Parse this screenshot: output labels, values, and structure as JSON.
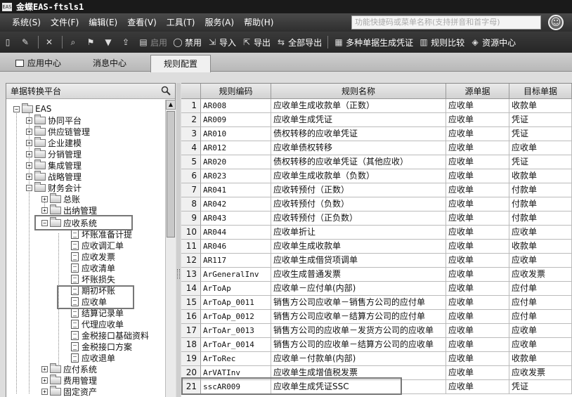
{
  "window": {
    "app_icon": "EAS",
    "title": "金蝶EAS-ftsls1"
  },
  "menu": [
    "系统(S)",
    "文件(F)",
    "编辑(E)",
    "查看(V)",
    "工具(T)",
    "服务(A)",
    "帮助(H)"
  ],
  "search": {
    "placeholder": "功能快捷码或菜单名称(支持拼音和首字母)"
  },
  "toolbar": {
    "icons_only": [
      "new-icon",
      "edit-icon",
      "delete-icon",
      "find-icon",
      "locate-icon",
      "filter-icon",
      "upload-icon"
    ],
    "enable_label": "启用",
    "disable_label": "禁用",
    "import_label": "导入",
    "export_label": "导出",
    "export_all_label": "全部导出",
    "multi_gen_label": "多种单据生成凭证",
    "compare_label": "规则比较",
    "resource_label": "资源中心"
  },
  "tabs": [
    "应用中心",
    "消息中心",
    "规则配置"
  ],
  "tree": {
    "header": "单据转换平台",
    "root": "EAS",
    "level1": [
      "协同平台",
      "供应链管理",
      "企业建模",
      "分销管理",
      "集成管理",
      "战略管理",
      "财务会计"
    ],
    "finance": [
      "总账",
      "出纳管理",
      "应收系统"
    ],
    "ar_children": [
      "坏账准备计提",
      "应收调汇单",
      "应收发票",
      "应收清单",
      "坏账损失",
      "期初坏账",
      "应收单",
      "结算记录单",
      "代理应收单",
      "金税接口基础资料",
      "金税接口方案",
      "应收退单"
    ],
    "after": [
      "应付系统",
      "费用管理",
      "固定资产"
    ]
  },
  "table": {
    "headers": [
      "规则编码",
      "规则名称",
      "源单据",
      "目标单据"
    ],
    "rows": [
      {
        "no": "1",
        "code": "AR008",
        "name": "应收单生成收款单（正数）",
        "src": "应收单",
        "tgt": "收款单"
      },
      {
        "no": "2",
        "code": "AR009",
        "name": "应收单生成凭证",
        "src": "应收单",
        "tgt": "凭证"
      },
      {
        "no": "3",
        "code": "AR010",
        "name": "债权转移的应收单凭证",
        "src": "应收单",
        "tgt": "凭证"
      },
      {
        "no": "4",
        "code": "AR012",
        "name": "应收单债权转移",
        "src": "应收单",
        "tgt": "应收单"
      },
      {
        "no": "5",
        "code": "AR020",
        "name": "债权转移的应收单凭证（其他应收）",
        "src": "应收单",
        "tgt": "凭证"
      },
      {
        "no": "6",
        "code": "AR023",
        "name": "应收单生成收款单（负数）",
        "src": "应收单",
        "tgt": "收款单"
      },
      {
        "no": "7",
        "code": "AR041",
        "name": "应收转预付（正数）",
        "src": "应收单",
        "tgt": "付款单"
      },
      {
        "no": "8",
        "code": "AR042",
        "name": "应收转预付（负数）",
        "src": "应收单",
        "tgt": "付款单"
      },
      {
        "no": "9",
        "code": "AR043",
        "name": "应收转预付（正负数）",
        "src": "应收单",
        "tgt": "付款单"
      },
      {
        "no": "10",
        "code": "AR044",
        "name": "应收单折让",
        "src": "应收单",
        "tgt": "应收单"
      },
      {
        "no": "11",
        "code": "AR046",
        "name": "应收单生成收款单",
        "src": "应收单",
        "tgt": "收款单"
      },
      {
        "no": "12",
        "code": "AR117",
        "name": "应收单生成借贷项调单",
        "src": "应收单",
        "tgt": "应收单"
      },
      {
        "no": "13",
        "code": "ArGeneralInv",
        "name": "应收生成普通发票",
        "src": "应收单",
        "tgt": "应收发票"
      },
      {
        "no": "14",
        "code": "ArToAp",
        "name": "应收单－应付单(内部)",
        "src": "应收单",
        "tgt": "应付单"
      },
      {
        "no": "15",
        "code": "ArToAp_0011",
        "name": "销售方公司应收单－销售方公司的应付单",
        "src": "应收单",
        "tgt": "应付单"
      },
      {
        "no": "16",
        "code": "ArToAp_0012",
        "name": "销售方公司应收单－结算方公司的应付单",
        "src": "应收单",
        "tgt": "应付单"
      },
      {
        "no": "17",
        "code": "ArToAr_0013",
        "name": "销售方公司的应收单－发货方公司的应收单",
        "src": "应收单",
        "tgt": "应收单"
      },
      {
        "no": "18",
        "code": "ArToAr_0014",
        "name": "销售方公司的应收单－结算方公司的应收单",
        "src": "应收单",
        "tgt": "应收单"
      },
      {
        "no": "19",
        "code": "ArToRec",
        "name": "应收单－付款单(内部)",
        "src": "应收单",
        "tgt": "收款单"
      },
      {
        "no": "20",
        "code": "ArVATInv",
        "name": "应收单生成增值税发票",
        "src": "应收单",
        "tgt": "应收发票"
      },
      {
        "no": "21",
        "code": "sscAR009",
        "name": "应收单生成凭证SSC",
        "src": "应收单",
        "tgt": "凭证"
      }
    ]
  }
}
